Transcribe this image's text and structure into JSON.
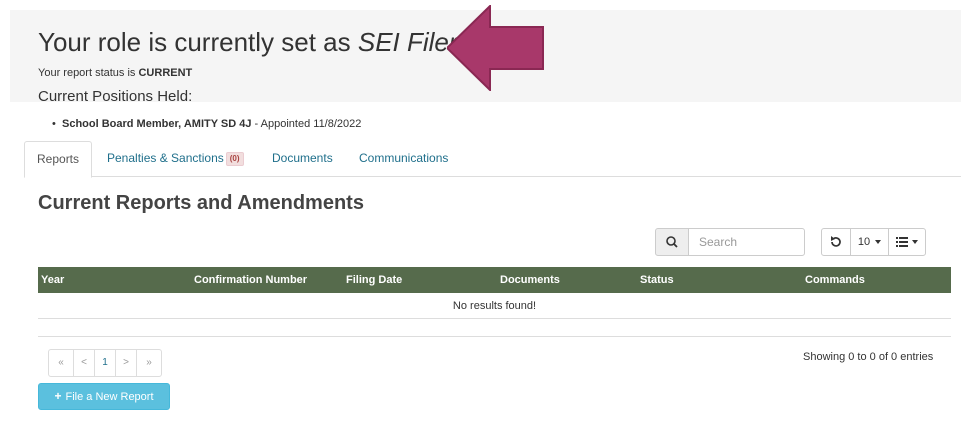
{
  "header": {
    "role_prefix": "Your role is currently set as ",
    "role_name": "SEI Filer.",
    "status_prefix": "Your report status is ",
    "status_value": "CURRENT",
    "positions_title": "Current Positions Held:"
  },
  "positions": [
    {
      "title": "School Board Member, AMITY SD 4J",
      "appointed": " - Appointed 11/8/2022"
    }
  ],
  "tabs": [
    {
      "label": "Reports",
      "active": true
    },
    {
      "label": "Penalties & Sanctions",
      "badge": "(0)"
    },
    {
      "label": "Documents"
    },
    {
      "label": "Communications"
    }
  ],
  "section": {
    "title": "Current Reports and Amendments"
  },
  "search": {
    "placeholder": "Search",
    "icon": "search-icon"
  },
  "toolbar": {
    "page_size": "10",
    "refresh_icon": "refresh-icon",
    "columns_icon": "columns-list-icon"
  },
  "table": {
    "columns": [
      "Year",
      "Confirmation Number",
      "Filing Date",
      "Documents",
      "Status",
      "Commands"
    ],
    "empty_message": "No results found!",
    "header_color": "#566b4c"
  },
  "pagination": {
    "first": "«",
    "prev": "<",
    "current": "1",
    "next": ">",
    "last": "»",
    "summary": "Showing 0 to 0 of 0 entries"
  },
  "actions": {
    "new_report": "File a New Report",
    "new_report_color": "#5bc0de"
  },
  "annotation": {
    "arrow_color": "#a8386a"
  }
}
